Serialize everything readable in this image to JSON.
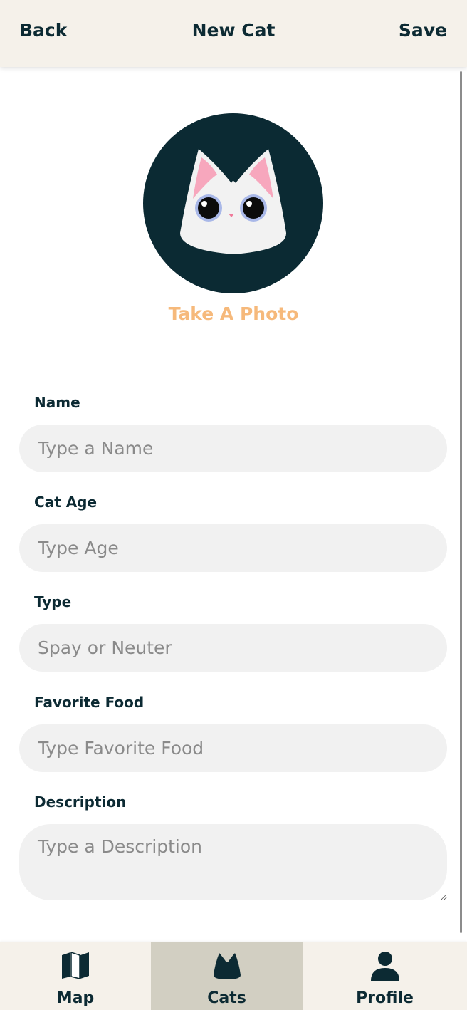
{
  "header": {
    "back_label": "Back",
    "title": "New Cat",
    "save_label": "Save"
  },
  "photo": {
    "take_photo_label": "Take A Photo"
  },
  "form": {
    "name": {
      "label": "Name",
      "placeholder": "Type a Name",
      "value": ""
    },
    "age": {
      "label": "Cat Age",
      "placeholder": "Type Age",
      "value": ""
    },
    "type": {
      "label": "Type",
      "placeholder": "Spay or Neuter",
      "value": ""
    },
    "food": {
      "label": "Favorite Food",
      "placeholder": "Type Favorite Food",
      "value": ""
    },
    "description": {
      "label": "Description",
      "placeholder": "Type a Description",
      "value": ""
    }
  },
  "tabbar": {
    "active": "Cats",
    "tabs": [
      {
        "label": "Map",
        "icon": "map-icon"
      },
      {
        "label": "Cats",
        "icon": "cat-icon"
      },
      {
        "label": "Profile",
        "icon": "person-icon"
      }
    ]
  },
  "colors": {
    "primary": "#0c2a33",
    "accent": "#f6b97b",
    "header_bg": "#f5f1ea",
    "field_bg": "#f1f1f1",
    "tab_active_bg": "#d2cfc2"
  }
}
